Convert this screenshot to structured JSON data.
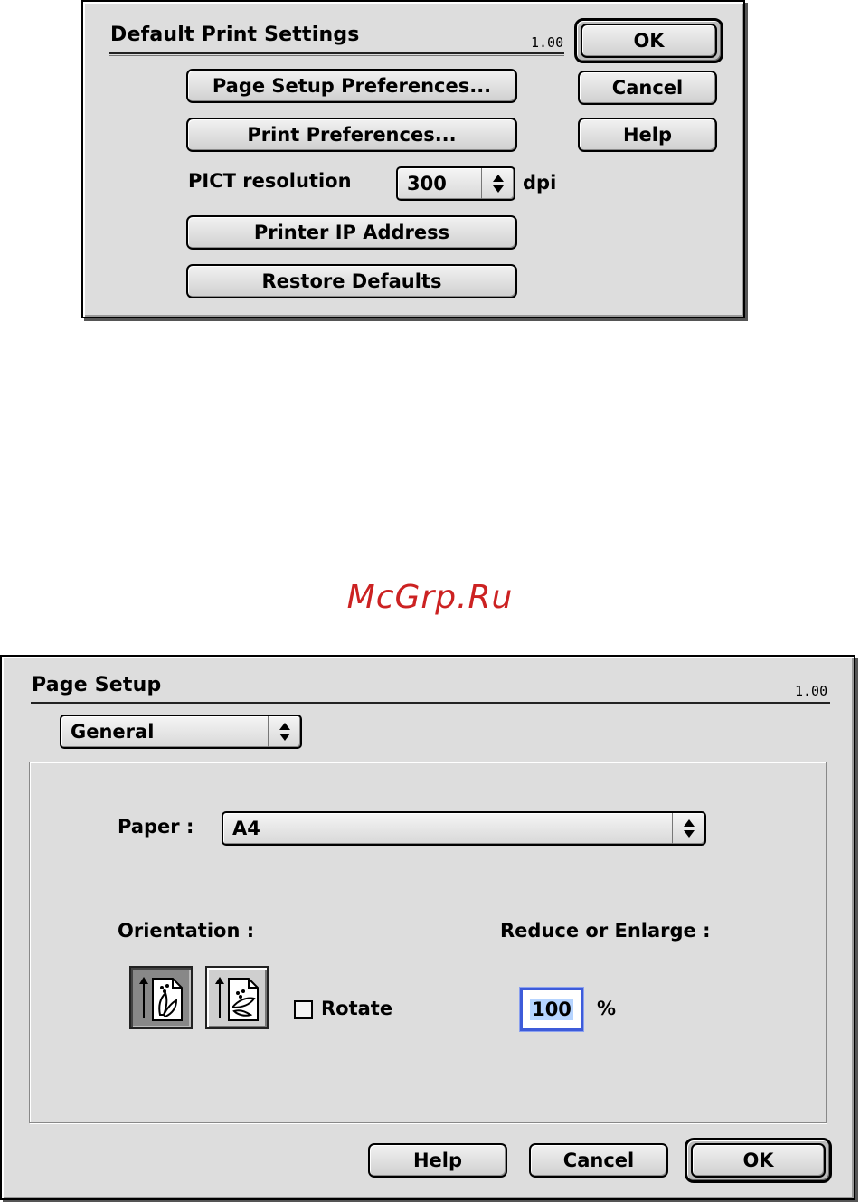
{
  "dialog1": {
    "title": "Default Print Settings",
    "version": "1.00",
    "ok_label": "OK",
    "cancel_label": "Cancel",
    "help_label": "Help",
    "page_setup_prefs_label": "Page Setup Preferences...",
    "print_prefs_label": "Print Preferences...",
    "pict_label": "PICT resolution",
    "pict_value": "300",
    "pict_unit": "dpi",
    "printer_ip_label": "Printer IP Address",
    "restore_defaults_label": "Restore Defaults"
  },
  "watermark": "McGrp.Ru",
  "dialog2": {
    "title": "Page Setup",
    "version": "1.00",
    "section_select": "General",
    "paper_label": "Paper :",
    "paper_value": "A4",
    "orientation_label": "Orientation :",
    "orientation_options": [
      "portrait",
      "landscape"
    ],
    "orientation_selected": "portrait",
    "rotate_label": "Rotate",
    "rotate_checked": false,
    "reduce_label": "Reduce or Enlarge :",
    "scale_value": "100",
    "scale_unit": "%",
    "help_label": "Help",
    "cancel_label": "Cancel",
    "ok_label": "OK"
  },
  "colors": {
    "dialog_bg": "#dddddd",
    "focus_ring": "#3d5bd9",
    "watermark": "#cc2222"
  },
  "icons": {
    "updown": "up-down-arrows-icon",
    "portrait": "portrait-orientation-icon",
    "landscape": "landscape-orientation-icon"
  }
}
